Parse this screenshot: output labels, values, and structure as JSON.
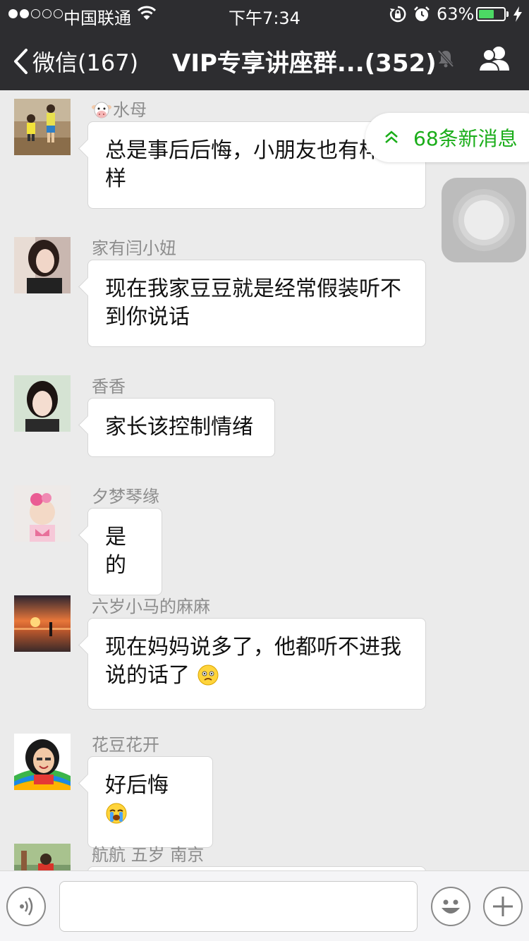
{
  "status_bar": {
    "carrier": "中国联通",
    "time": "下午7:34",
    "battery_percent": "63%",
    "battery_level": 0.63,
    "signal_bars_on": 2,
    "signal_bars_total": 5
  },
  "nav": {
    "back_label": "微信(167)",
    "title": "VIP专享讲座群...(352)"
  },
  "new_messages": {
    "label": "68条新消息"
  },
  "messages": [
    {
      "sender": "水母",
      "text": "总是事后后悔，小朋友也有样学样"
    },
    {
      "sender": "家有闫小妞",
      "text": "现在我家豆豆就是经常假装听不到你说话"
    },
    {
      "sender": "香香",
      "text": "家长该控制情绪"
    },
    {
      "sender": "夕梦琴缘",
      "text": "是的"
    },
    {
      "sender": "六岁小马的麻麻",
      "text": "现在妈妈说多了，他都听不进我说的话了"
    },
    {
      "sender": "花豆花开",
      "text": "好后悔"
    },
    {
      "sender": "航航 五岁 南京",
      "text": ""
    }
  ],
  "input": {
    "value": "",
    "placeholder": ""
  },
  "colors": {
    "nav_bg": "#2d2d30",
    "chat_bg": "#ebebeb",
    "accent_green": "#1aad19",
    "battery_green": "#4cd964"
  }
}
